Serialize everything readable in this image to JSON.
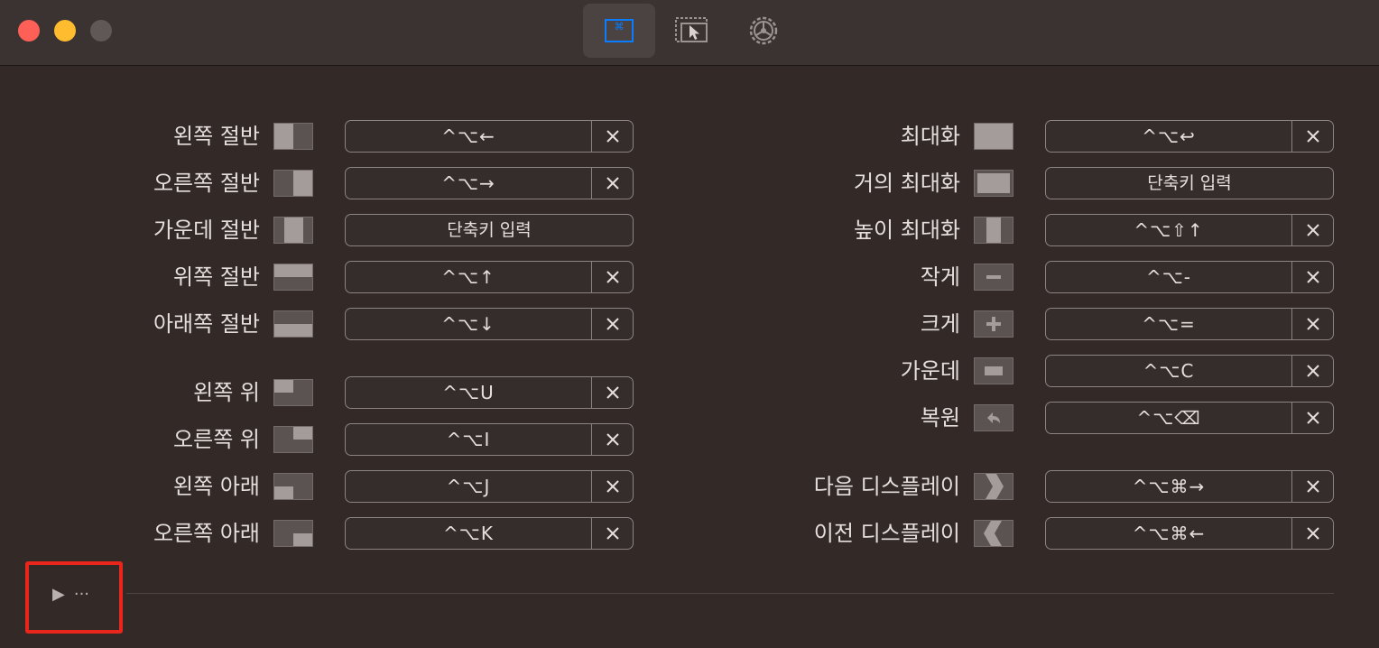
{
  "window": {
    "toolbar_tabs": [
      {
        "icon": "keyboard-shortcut-icon",
        "active": true
      },
      {
        "icon": "snap-area-icon",
        "active": false
      },
      {
        "icon": "gear-icon",
        "active": false
      }
    ]
  },
  "colors": {
    "accent": "#0a7cff",
    "close": "#fe5f57",
    "minimize": "#febc2e"
  },
  "left_rows": [
    {
      "label": "왼쪽 절반",
      "shortcut": "^⌥←",
      "empty": false,
      "icon": "left-half-icon"
    },
    {
      "label": "오른쪽 절반",
      "shortcut": "^⌥→",
      "empty": false,
      "icon": "right-half-icon"
    },
    {
      "label": "가운데 절반",
      "shortcut": "단축키 입력",
      "empty": true,
      "icon": "center-half-icon"
    },
    {
      "label": "위쪽 절반",
      "shortcut": "^⌥↑",
      "empty": false,
      "icon": "top-half-icon"
    },
    {
      "label": "아래쪽 절반",
      "shortcut": "^⌥↓",
      "empty": false,
      "icon": "bottom-half-icon"
    },
    {
      "label": "왼쪽 위",
      "shortcut": "^⌥U",
      "empty": false,
      "icon": "top-left-icon"
    },
    {
      "label": "오른쪽 위",
      "shortcut": "^⌥I",
      "empty": false,
      "icon": "top-right-icon"
    },
    {
      "label": "왼쪽 아래",
      "shortcut": "^⌥J",
      "empty": false,
      "icon": "bottom-left-icon"
    },
    {
      "label": "오른쪽 아래",
      "shortcut": "^⌥K",
      "empty": false,
      "icon": "bottom-right-icon"
    }
  ],
  "right_rows": [
    {
      "label": "최대화",
      "shortcut": "^⌥↩",
      "empty": false,
      "icon": "maximize-icon"
    },
    {
      "label": "거의 최대화",
      "shortcut": "단축키 입력",
      "empty": true,
      "icon": "almost-maximize-icon"
    },
    {
      "label": "높이 최대화",
      "shortcut": "^⌥⇧↑",
      "empty": false,
      "icon": "maximize-height-icon"
    },
    {
      "label": "작게",
      "shortcut": "^⌥-",
      "empty": false,
      "icon": "smaller-icon"
    },
    {
      "label": "크게",
      "shortcut": "^⌥=",
      "empty": false,
      "icon": "larger-icon"
    },
    {
      "label": "가운데",
      "shortcut": "^⌥C",
      "empty": false,
      "icon": "center-icon"
    },
    {
      "label": "복원",
      "shortcut": "^⌥⌫",
      "empty": false,
      "icon": "restore-icon"
    },
    {
      "label": "다음 디스플레이",
      "shortcut": "^⌥⌘→",
      "empty": false,
      "icon": "next-display-icon"
    },
    {
      "label": "이전 디스플레이",
      "shortcut": "^⌥⌘←",
      "empty": false,
      "icon": "previous-display-icon"
    }
  ],
  "footer": {
    "disclosure_icon": "play-triangle-icon",
    "more_icon": "ellipsis-icon"
  }
}
